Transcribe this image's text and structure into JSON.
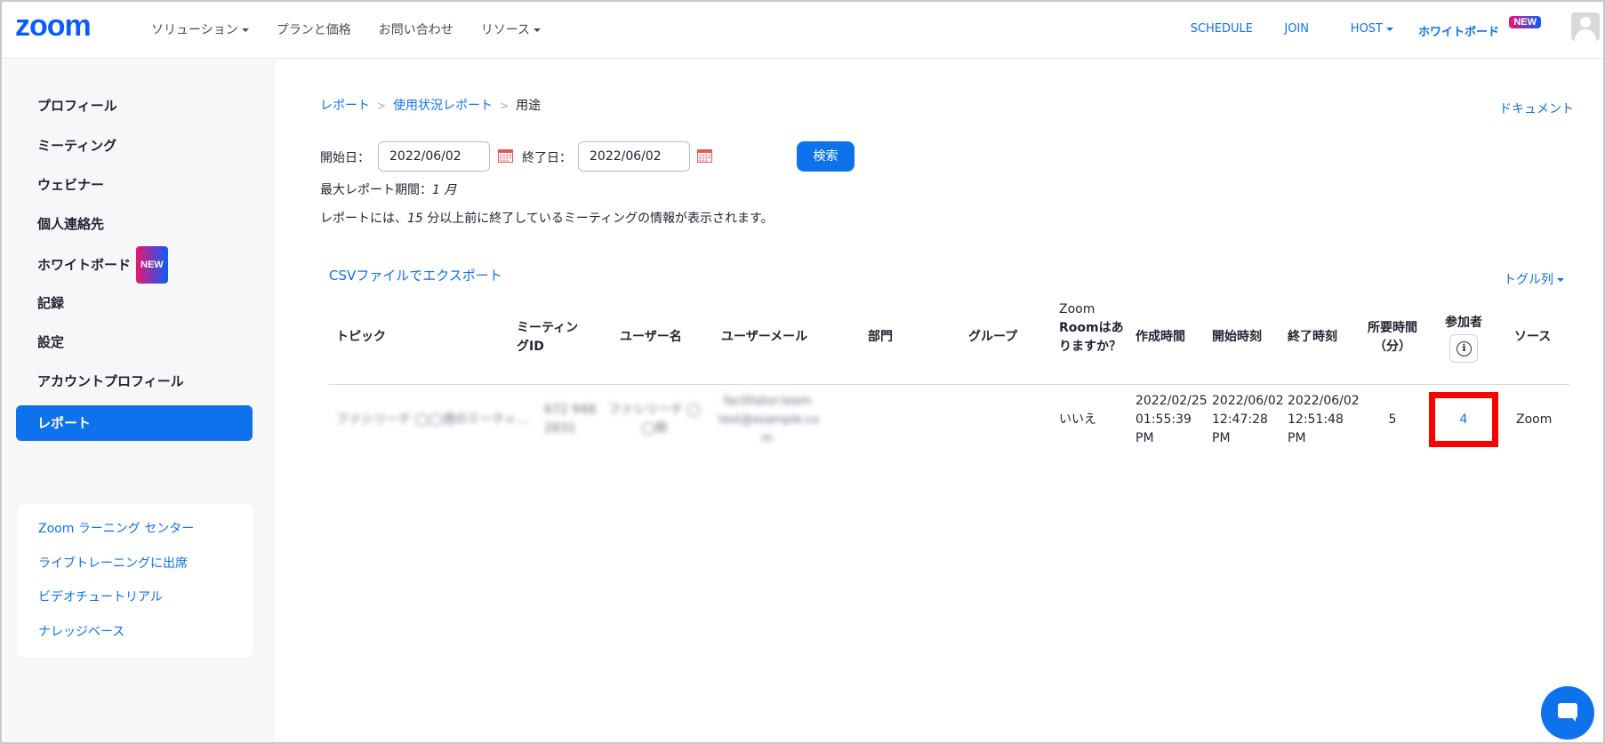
{
  "header": {
    "logo": "zoom",
    "nav": [
      "ソリューション",
      "プランと価格",
      "お問い合わせ",
      "リソース"
    ],
    "right": {
      "schedule": "SCHEDULE",
      "join": "JOIN",
      "host": "HOST",
      "whiteboard": "ホワイトボード",
      "new_badge": "NEW"
    }
  },
  "sidebar": {
    "items": [
      "プロフィール",
      "ミーティング",
      "ウェビナー",
      "個人連絡先",
      "ホワイトボード",
      "記録",
      "設定",
      "アカウントプロフィール",
      "レポート"
    ],
    "new_badge": "NEW",
    "active": "レポート",
    "help_links": [
      "Zoom ラーニング センター",
      "ライブトレーニングに出席",
      "ビデオチュートリアル",
      "ナレッジベース"
    ]
  },
  "main": {
    "breadcrumb": [
      "レポート",
      "使用状況レポート",
      "用途"
    ],
    "doc_link": "ドキュメント",
    "start_label": "開始日：",
    "start_date": "2022/06/02",
    "end_label": "終了日：",
    "end_date": "2022/06/02",
    "search_button": "検索",
    "max_period": "最大レポート期間：",
    "max_period_value": "1 月",
    "info_note_pre": "レポートには、",
    "info_note_num": "15",
    "info_note_post": " 分以上前に終了しているミーティングの情報が表示されます。",
    "csv_export": "CSVファイルでエクスポート",
    "toggle_columns": "トグル列"
  },
  "table": {
    "headers": {
      "topic": "トピック",
      "meeting_id_1": "ミーティン",
      "meeting_id_2": "グID",
      "user_name": "ユーザー名",
      "user_email": "ユーザーメール",
      "department": "部門",
      "group": "グループ",
      "zoom_room_1": "Zoom",
      "zoom_room_2": "Roomはあ",
      "zoom_room_3": "りますか？",
      "created": "作成時間",
      "start": "開始時刻",
      "end": "終了時刻",
      "duration_1": "所要時間",
      "duration_2": "（分）",
      "participants": "参加者",
      "source": "ソース"
    },
    "row": {
      "topic": "ファシリーテ ◯◯週のミーティ...",
      "meeting_id_1": "672 948",
      "meeting_id_2": "2831",
      "user_name_1": "ファシリーテ ◯",
      "user_name_2": "◯郎",
      "user_email_1": "facilitator.team",
      "user_email_2": "test@example.co",
      "user_email_3": "m",
      "zoom_room": "いいえ",
      "created_1": "2022/02/25",
      "created_2": "01:55:39",
      "created_3": "PM",
      "start_1": "2022/06/02",
      "start_2": "12:47:28",
      "start_3": "PM",
      "end_1": "2022/06/02",
      "end_2": "12:51:48",
      "end_3": "PM",
      "duration": "5",
      "participants": "4",
      "source": "Zoom"
    }
  },
  "colors": {
    "brand": "#0b5cff",
    "link": "#0e72ed",
    "highlight": "#ff0000"
  }
}
